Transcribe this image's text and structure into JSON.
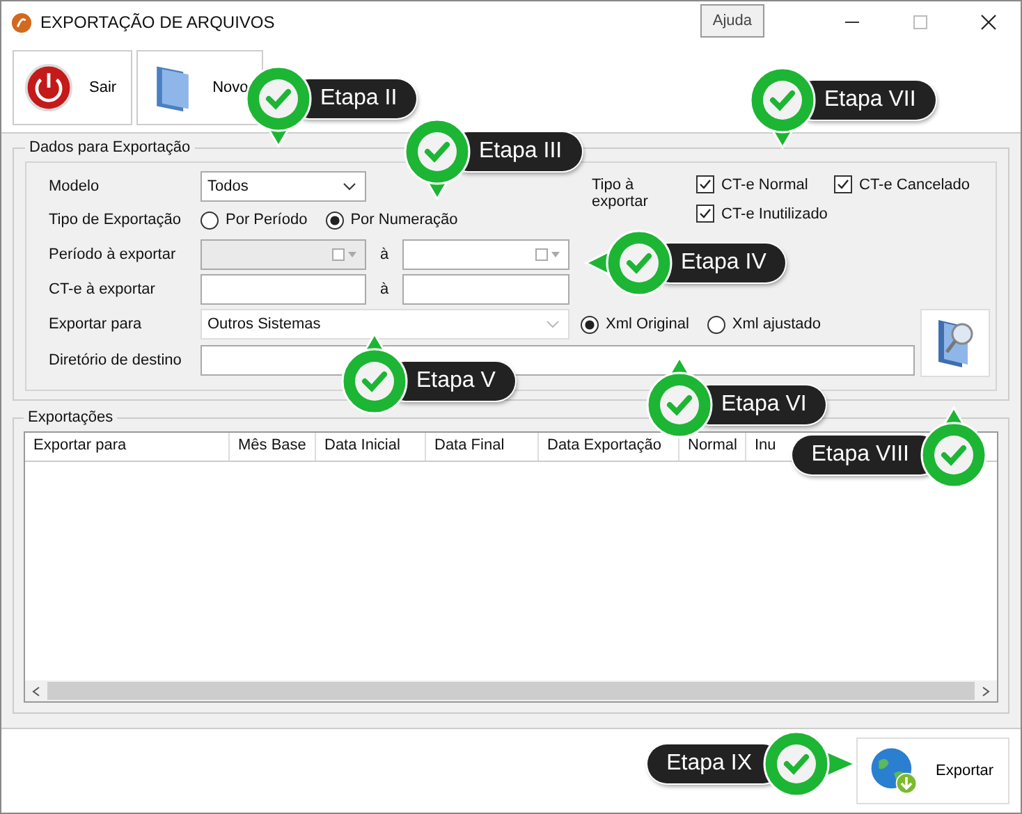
{
  "window": {
    "title": "EXPORTAÇÃO DE ARQUIVOS",
    "help_button": "Ajuda"
  },
  "toolbar": [
    {
      "label": "Sair",
      "kind": "exit"
    },
    {
      "label": "Novo",
      "kind": "new"
    }
  ],
  "export_data": {
    "title": "Dados para Exportação",
    "modelo": {
      "label": "Modelo",
      "value": "Todos"
    },
    "tipo_exportacao": {
      "label": "Tipo de Exportação",
      "options": [
        {
          "label": "Por Período",
          "selected": false
        },
        {
          "label": "Por Numeração",
          "selected": true
        }
      ]
    },
    "periodo": {
      "label": "Período à exportar",
      "separator": "à",
      "from_disabled": true
    },
    "cte": {
      "label": "CT-e à exportar",
      "separator": "à"
    },
    "exportar_para": {
      "label": "Exportar para",
      "value": "Outros Sistemas",
      "options": [
        {
          "label": "Xml Original",
          "selected": true
        },
        {
          "label": "Xml ajustado",
          "selected": false
        }
      ]
    },
    "diretorio": {
      "label": "Diretório de destino"
    },
    "tipo_a_exportar": {
      "label": "Tipo à exportar",
      "options": [
        {
          "label": "CT-e Normal",
          "checked": true
        },
        {
          "label": "CT-e Cancelado",
          "checked": true
        },
        {
          "label": "CT-e Inutilizado",
          "checked": true
        }
      ]
    }
  },
  "exports": {
    "title": "Exportações",
    "columns": [
      "Exportar para",
      "Mês Base",
      "Data Inicial",
      "Data Final",
      "Data Exportação",
      "Normal",
      "Inu"
    ]
  },
  "footer": {
    "export_button": "Exportar"
  },
  "callouts": [
    {
      "label": "Etapa II",
      "kind": "down"
    },
    {
      "label": "Etapa III",
      "kind": "down"
    },
    {
      "label": "Etapa VII",
      "kind": "down"
    },
    {
      "label": "Etapa IV",
      "kind": "left"
    },
    {
      "label": "Etapa V",
      "kind": "up"
    },
    {
      "label": "Etapa VI",
      "kind": "up"
    },
    {
      "label": "Etapa VIII",
      "kind": "up"
    },
    {
      "label": "Etapa IX",
      "kind": "right"
    }
  ]
}
